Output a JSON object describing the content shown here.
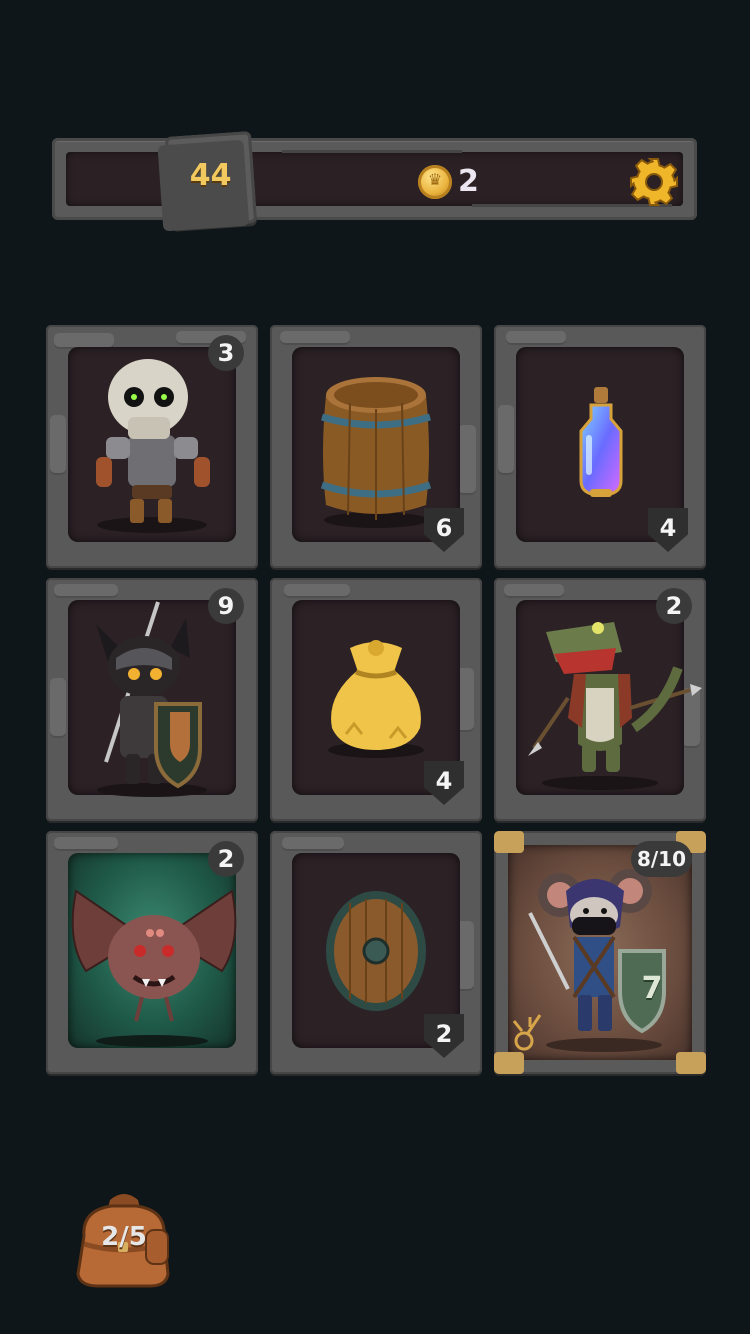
{
  "header": {
    "level": "44",
    "coins": "2"
  },
  "icons": {
    "level": "stone-tile-icon",
    "currency": "gold-coin-icon",
    "settings": "gear-icon",
    "inventory": "backpack-icon"
  },
  "colors": {
    "background": "#0f1619",
    "stone": "#595959",
    "card_inner": "#2c2226",
    "gold": "#f1c95f",
    "bat_glow": "#3c8a72"
  },
  "cards": [
    {
      "name": "skeleton",
      "value": "3"
    },
    {
      "name": "barrel",
      "value": "6"
    },
    {
      "name": "potion",
      "value": "4"
    },
    {
      "name": "cat-knight",
      "value": "9"
    },
    {
      "name": "gold-sack",
      "value": "4"
    },
    {
      "name": "crocodile",
      "value": "2"
    },
    {
      "name": "bat",
      "value": "2"
    },
    {
      "name": "shield",
      "value": "2"
    },
    {
      "name": "mouse-hero",
      "health": "8/10",
      "shield": "7"
    }
  ],
  "inventory": {
    "count": "2/5"
  }
}
